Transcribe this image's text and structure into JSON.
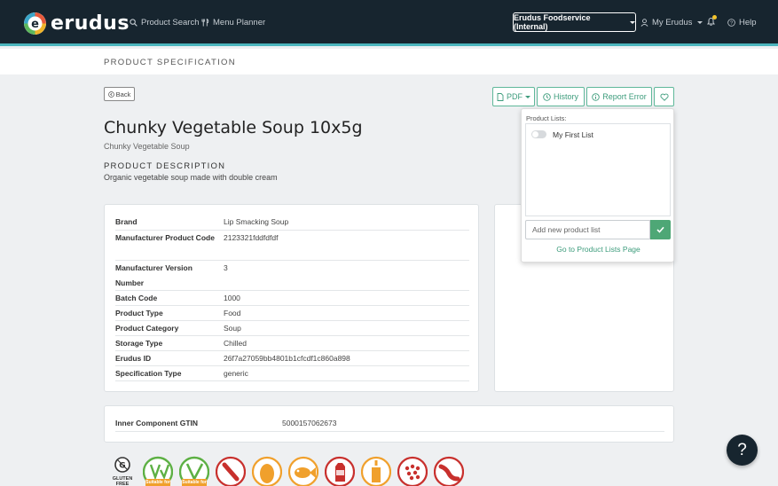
{
  "nav": {
    "logo_text": "erudus",
    "links": [
      {
        "label": "Product Search",
        "icon": "search-icon"
      },
      {
        "label": "Menu Planner",
        "icon": "cutlery-icon"
      }
    ],
    "org_selector": "Erudus Foodservice (Internal)",
    "account_label": "My Erudus",
    "help_label": "Help",
    "accent_color": "#4bb5bd",
    "notification_color": "#f3c42c"
  },
  "page": {
    "section_title": "PRODUCT SPECIFICATION",
    "back_label": "Back"
  },
  "toolbar": {
    "pdf_label": "PDF",
    "history_label": "History",
    "report_label": "Report Error",
    "favourite_icon": "heart-icon"
  },
  "product": {
    "title": "Chunky Vegetable Soup 10x5g",
    "subtitle": "Chunky Vegetable Soup",
    "description_heading": "PRODUCT DESCRIPTION",
    "description": "Organic vegetable soup made with double cream"
  },
  "specs": [
    {
      "key": "Brand",
      "value": "Lip Smacking Soup"
    },
    {
      "key": "Manufacturer Product Code",
      "value": "2123321fddfdfdf"
    },
    {
      "key": "Manufacturer Version Number",
      "value": "3"
    },
    {
      "key": "Batch Code",
      "value": "1000"
    },
    {
      "key": "Product Type",
      "value": "Food"
    },
    {
      "key": "Product Category",
      "value": "Soup"
    },
    {
      "key": "Storage Type",
      "value": "Chilled"
    },
    {
      "key": "Erudus ID",
      "value": "26f7a27059bb4801b1cfcdf1c860a898"
    },
    {
      "key": "Specification Type",
      "value": "generic"
    }
  ],
  "component": {
    "key": "Inner Component GTIN",
    "value": "5000157062673"
  },
  "product_lists": {
    "label": "Product Lists:",
    "items": [
      {
        "name": "My First List",
        "enabled": false
      }
    ],
    "new_placeholder": "Add new product list",
    "go_link": "Go to Product Lists Page"
  },
  "dietary_icons": [
    {
      "icon": "gluten-free-icon",
      "caption": "GLUTEN FREE"
    },
    {
      "icon": "vegetarian-icon",
      "caption": "Suitable for"
    },
    {
      "icon": "vegan-icon",
      "caption": "Suitable for"
    },
    {
      "icon": "celery-icon"
    },
    {
      "icon": "egg-icon"
    },
    {
      "icon": "fish-icon"
    },
    {
      "icon": "milk-icon"
    },
    {
      "icon": "mustard-icon"
    },
    {
      "icon": "sesame-icon"
    },
    {
      "icon": "sulphites-icon"
    }
  ],
  "help_fab": "?"
}
